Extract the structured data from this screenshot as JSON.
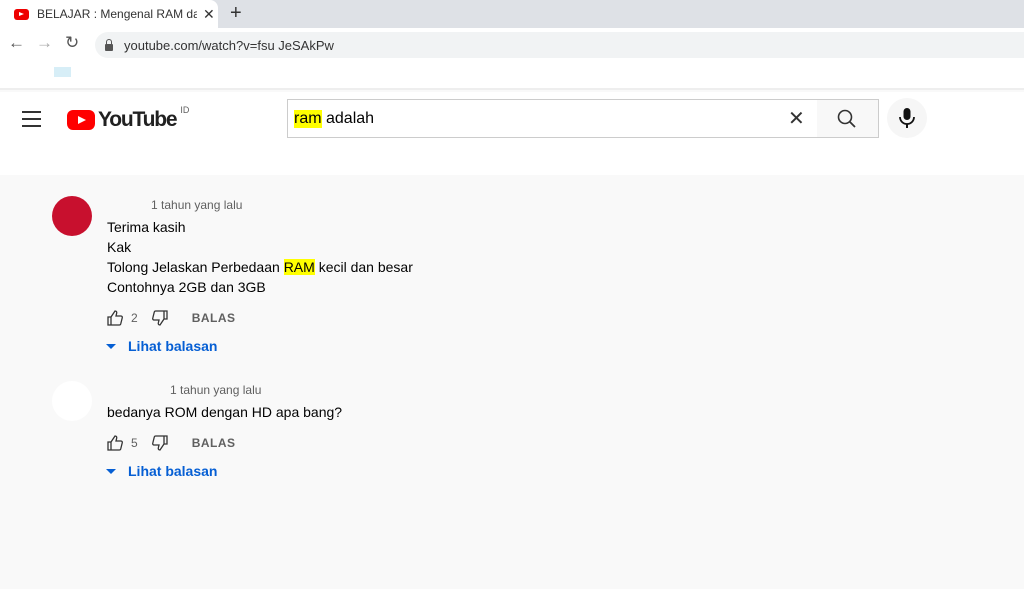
{
  "browser": {
    "tab_title": "BELAJAR : Mengenal RAM dan R",
    "url": "youtube.com/watch?v=fsu  JeSAkPw"
  },
  "header": {
    "logo_text": "YouTube",
    "country_code": "ID",
    "search_query_highlight": "ram",
    "search_query_rest": " adalah"
  },
  "colors": {
    "accent_link": "#065fd4",
    "highlight": "#ffff00",
    "brand": "#ff0000"
  },
  "comments": [
    {
      "time": "1 tahun yang lalu",
      "avatar_color": "#c8102e",
      "lines": [
        "Terima kasih",
        "Kak"
      ],
      "line3_pre": "Tolong Jelaskan Perbedaan ",
      "line3_hl": "RAM",
      "line3_post": " kecil dan besar",
      "line4": "Contohnya 2GB dan 3GB",
      "likes": "2",
      "reply_label": "BALAS",
      "view_replies": "Lihat balasan"
    },
    {
      "time": "1 tahun yang lalu",
      "avatar_color": "#ffffff",
      "text": "bedanya ROM dengan HD apa bang?",
      "likes": "5",
      "reply_label": "BALAS",
      "view_replies": "Lihat balasan"
    }
  ]
}
